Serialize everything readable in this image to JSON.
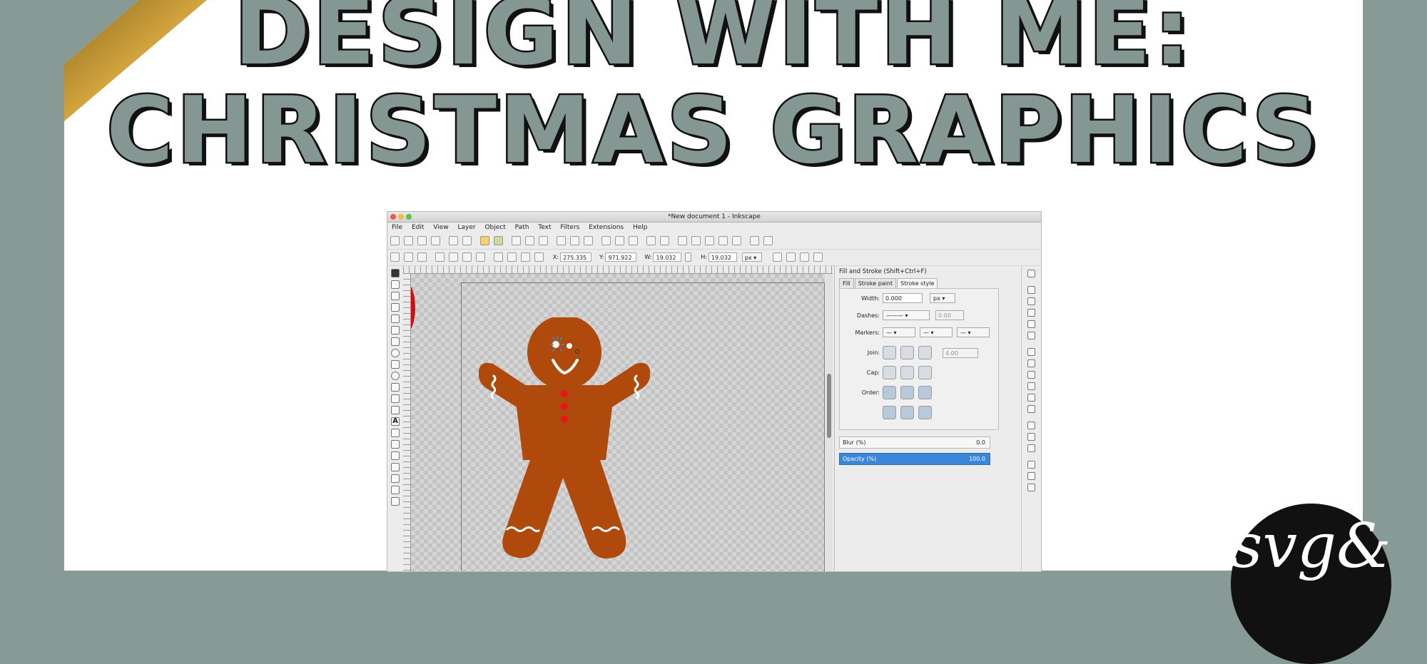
{
  "title": {
    "line1": "DESIGN WITH ME:",
    "line2": "CHRISTMAS GRAPHICS"
  },
  "badge": {
    "text": "svg&"
  },
  "inkscape": {
    "window_title": "*New document 1 - Inkscape",
    "menu": [
      "File",
      "Edit",
      "View",
      "Layer",
      "Object",
      "Path",
      "Text",
      "Filters",
      "Extensions",
      "Help"
    ],
    "toolbar": {
      "x_label": "X:",
      "x_value": "275.335",
      "y_label": "Y:",
      "y_value": "971.922",
      "w_label": "W:",
      "w_value": "19.032",
      "h_label": "H:",
      "h_value": "19.032",
      "unit": "px"
    },
    "dock": {
      "title": "Fill and Stroke (Shift+Ctrl+F)",
      "tabs": [
        "Fill",
        "Stroke paint",
        "Stroke style"
      ],
      "width_label": "Width:",
      "width_value": "0.000",
      "width_unit": "px",
      "dashes_label": "Dashes:",
      "dashes_value": "0.00",
      "markers_label": "Markers:",
      "marker_value": "—",
      "join_label": "Join:",
      "miter_value": "4.00",
      "cap_label": "Cap:",
      "order_label": "Order:",
      "blur_label": "Blur (%)",
      "blur_value": "0.0",
      "opacity_label": "Opacity (%)",
      "opacity_value": "100.0"
    }
  },
  "colors": {
    "frame": "#879a96",
    "title_fill": "#859793",
    "gingerbread": "#b04a0c",
    "buttons": "#e8141a",
    "opacity_highlight": "#3b86d8"
  }
}
